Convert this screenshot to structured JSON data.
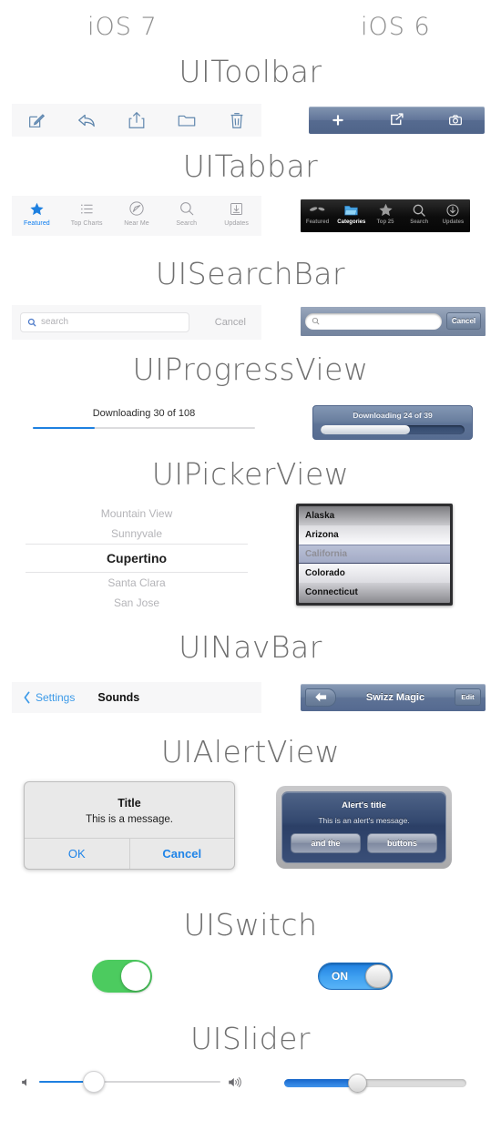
{
  "header": {
    "left_platform": "iOS 7",
    "right_platform": "iOS 6"
  },
  "sections": {
    "toolbar": {
      "title": "UIToolbar",
      "ios7_icons": [
        "compose-icon",
        "reply-icon",
        "share-icon",
        "folder-icon",
        "trash-icon"
      ],
      "ios6_icons": [
        "plus-icon",
        "share-icon",
        "camera-icon"
      ]
    },
    "tabbar": {
      "title": "UITabbar",
      "ios7_items": [
        {
          "label": "Featured",
          "icon": "star-icon",
          "active": true
        },
        {
          "label": "Top Charts",
          "icon": "list-icon",
          "active": false
        },
        {
          "label": "Near Me",
          "icon": "compass-icon",
          "active": false
        },
        {
          "label": "Search",
          "icon": "search-icon",
          "active": false
        },
        {
          "label": "Updates",
          "icon": "download-icon",
          "active": false
        }
      ],
      "ios6_items": [
        {
          "label": "Featured",
          "icon": "sparkle-icon",
          "active": false
        },
        {
          "label": "Categories",
          "icon": "folder-icon",
          "active": true
        },
        {
          "label": "Top 25",
          "icon": "star-icon",
          "active": false
        },
        {
          "label": "Search",
          "icon": "search-icon",
          "active": false
        },
        {
          "label": "Updates",
          "icon": "download-icon",
          "active": false
        }
      ]
    },
    "searchbar": {
      "title": "UISearchBar",
      "ios7_placeholder": "search",
      "ios7_cancel": "Cancel",
      "ios7_value": "",
      "ios6_placeholder": "",
      "ios6_cancel": "Cancel",
      "ios6_value": ""
    },
    "progressview": {
      "title": "UIProgressView",
      "ios7_caption": "Downloading 30 of 108",
      "ios7_percent": 28,
      "ios6_caption": "Downloading 24 of 39",
      "ios6_percent": 62
    },
    "pickerview": {
      "title": "UIPickerView",
      "ios7_rows": [
        "Mountain View",
        "Sunnyvale",
        "Cupertino",
        "Santa Clara",
        "San Jose"
      ],
      "ios7_selected_index": 2,
      "ios6_rows": [
        "Alaska",
        "Arizona",
        "California",
        "Colorado",
        "Connecticut"
      ],
      "ios6_selected_index": 2
    },
    "navbar": {
      "title": "UINavBar",
      "ios7_back": "Settings",
      "ios7_title": "Sounds",
      "ios6_title": "Swizz Magic",
      "ios6_edit": "Edit",
      "ios6_back_icon": "back-arrow-icon"
    },
    "alertview": {
      "title": "UIAlertView",
      "ios7_title": "Title",
      "ios7_message": "This is a message.",
      "ios7_buttons": [
        "OK",
        "Cancel"
      ],
      "ios6_title": "Alert's title",
      "ios6_message": "This is an alert's message.",
      "ios6_buttons": [
        "and the",
        "buttons"
      ]
    },
    "switch": {
      "title": "UISwitch",
      "ios7_state": "on",
      "ios6_label": "ON",
      "ios6_state": "on"
    },
    "slider": {
      "title": "UISlider",
      "ios7_percent": 30,
      "ios7_min_icon": "volume-min-icon",
      "ios7_max_icon": "volume-max-icon",
      "ios6_percent": 40
    }
  },
  "colors": {
    "ios7_blue": "#1e80e0",
    "ios7_green": "#4ccb5f",
    "ios7_bar_bg": "#f7f7f8",
    "ios6_blue": "#5e7396",
    "ios6_switch_blue": "#3fa0f0",
    "title_gray": "#6f6f6f"
  }
}
